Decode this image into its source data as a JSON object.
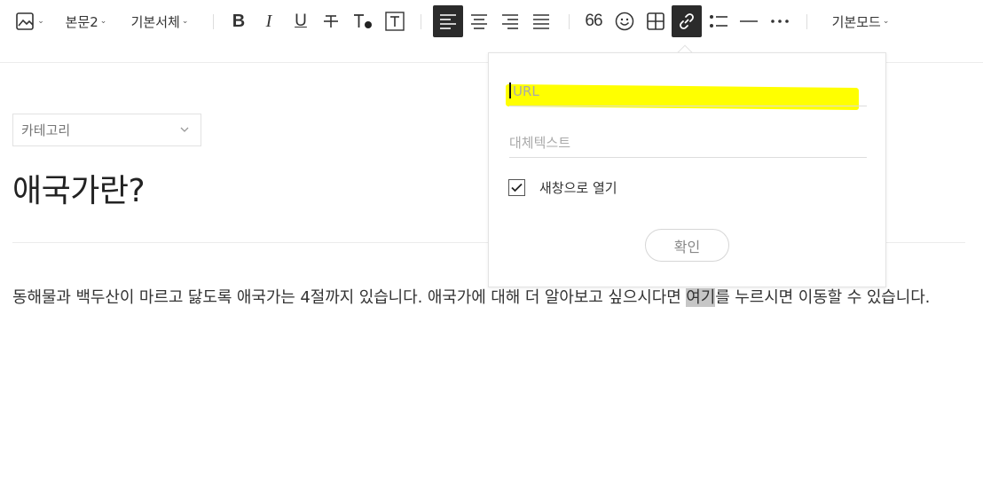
{
  "toolbar": {
    "paragraph_style": "본문2",
    "font_family": "기본서체",
    "quote_label": "66",
    "mode": "기본모드",
    "active_align": "left",
    "active_tool": "link"
  },
  "editor": {
    "category_placeholder": "카테고리",
    "title": "애국가란?",
    "body_before": "동해물과 백두산이 마르고 닳도록 애국가는 4절까지 있습니다. 애국가에 대해 더 알아보고 싶으시다면 ",
    "body_selected": "여기",
    "body_after": "를 누르시면 이동할 수 있습니다."
  },
  "link_popup": {
    "url_placeholder": "URL",
    "alt_placeholder": "대체텍스트",
    "new_window_label": "새창으로 열기",
    "new_window_checked": true,
    "confirm_label": "확인",
    "highlight_color": "#ffff00"
  },
  "colors": {
    "active_button_bg": "#2b2b2b",
    "selection_bg": "#c6c6c6"
  }
}
